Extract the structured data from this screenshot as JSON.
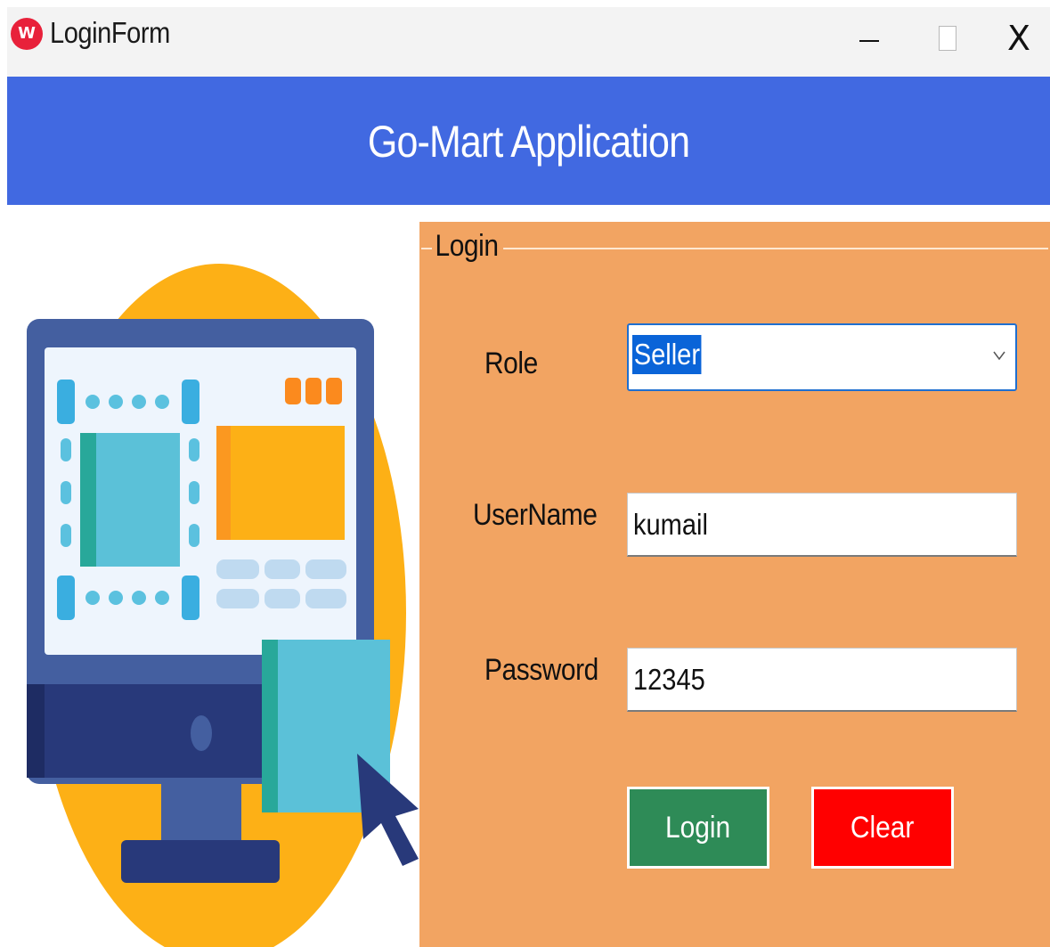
{
  "window": {
    "title": "LoginForm",
    "icon": "app-logo-icon",
    "close_glyph": "X"
  },
  "header": {
    "title": "Go-Mart Application",
    "background": "#4169e1"
  },
  "illustration": {
    "icon": "computer-monitor-illustration"
  },
  "login": {
    "group_label": "Login",
    "background": "#f2a462",
    "role": {
      "label": "Role",
      "selected": "Seller"
    },
    "username": {
      "label": "UserName",
      "value": "kumail"
    },
    "password": {
      "label": "Password",
      "value": "12345"
    },
    "buttons": {
      "login_label": "Login",
      "login_color": "#2e8b57",
      "clear_label": "Clear",
      "clear_color": "#ff0000"
    }
  }
}
